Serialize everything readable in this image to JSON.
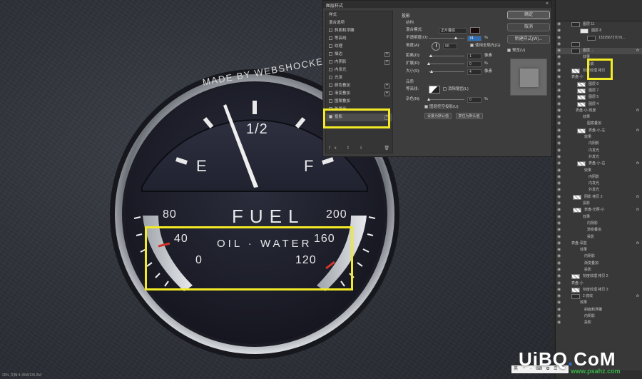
{
  "gauge": {
    "brand": "MADE BY WEBSHOCKER",
    "half": "1/2",
    "empty": "E",
    "full": "F",
    "title": "FUEL",
    "sub_title": "OIL · WATER",
    "left_scale": [
      "80",
      "40",
      "0"
    ],
    "right_scale": [
      "200",
      "160",
      "120"
    ],
    "needle_value": "≈ 1/2"
  },
  "dialog": {
    "title": "图层样式",
    "close": "×",
    "left_items": [
      {
        "label": "样式",
        "check": null
      },
      {
        "label": "混合选项",
        "check": null
      },
      {
        "label": "斜面和浮雕",
        "check": false
      },
      {
        "label": "等高线",
        "check": false
      },
      {
        "label": "纹理",
        "check": false
      },
      {
        "label": "描边",
        "check": false,
        "plus": true
      },
      {
        "label": "内阴影",
        "check": false,
        "plus": true
      },
      {
        "label": "内发光",
        "check": false
      },
      {
        "label": "光泽",
        "check": false
      },
      {
        "label": "颜色叠加",
        "check": false,
        "plus": true
      },
      {
        "label": "渐变叠加",
        "check": false,
        "plus": true
      },
      {
        "label": "图案叠加",
        "check": false
      },
      {
        "label": "外发光",
        "check": false
      },
      {
        "label": "投影",
        "check": true,
        "plus": true,
        "selected": true
      }
    ],
    "left_footer": "fx ⇧ ⇩",
    "trash": "🗑",
    "section": "投影",
    "subsection": "结构",
    "blend_label": "混合模式:",
    "blend_value": "正片叠底",
    "opacity_label": "不透明度(O):",
    "opacity_value": "74",
    "angle_label": "角度(A):",
    "angle_value": "90",
    "global_light": "使用全局光(G)",
    "distance_label": "距离(D):",
    "distance_value": "1",
    "spread_label": "扩展(R):",
    "spread_value": "0",
    "size_label": "大小(S):",
    "size_value": "4",
    "unit_px": "像素",
    "unit_pct": "%",
    "quality_head": "品质",
    "contour_label": "等高线:",
    "antialias": "消除锯齿(L)",
    "noise_label": "杂色(N):",
    "noise_value": "0",
    "knockout": "图层挖空投影(U)",
    "btn_default": "设置为默认值",
    "btn_reset": "复位为默认值",
    "ok": "确定",
    "cancel": "取消",
    "new_style": "新建样式(W)...",
    "preview": "预览(V)"
  },
  "layers": {
    "rows": [
      {
        "name": "图层 11",
        "thumb": "dark",
        "indent": 14,
        "fx": false
      },
      {
        "name": "图层 8",
        "thumb": "light",
        "indent": 26,
        "fx": false
      },
      {
        "name": "1332567270 N...",
        "thumb": "dark",
        "indent": 36,
        "fx": false
      },
      {
        "name": "",
        "thumb": "dark",
        "indent": 14,
        "fx": false
      },
      {
        "name": "图层 ...",
        "thumb": "dark",
        "indent": 14,
        "fx": true,
        "selected": true
      },
      {
        "name": "效果",
        "thumb": null,
        "indent": 26,
        "fx": false
      },
      {
        "name": "投影",
        "thumb": null,
        "indent": 32,
        "fx": false
      },
      {
        "name": "刻度纹理 拷贝",
        "thumb": "chk",
        "indent": 14,
        "fx": false
      },
      {
        "name": "表盘-小",
        "thumb": null,
        "indent": 10,
        "fx": false
      },
      {
        "name": "图层 6",
        "thumb": "chk",
        "indent": 22,
        "fx": false
      },
      {
        "name": "图层 7",
        "thumb": "chk",
        "indent": 22,
        "fx": false
      },
      {
        "name": "图层 5",
        "thumb": "chk",
        "indent": 22,
        "fx": false
      },
      {
        "name": "图层 4",
        "thumb": "chk",
        "indent": 22,
        "fx": false
      },
      {
        "name": "表盘-小-刻度",
        "thumb": null,
        "indent": 16,
        "fx": true
      },
      {
        "name": "效果",
        "thumb": null,
        "indent": 26,
        "fx": false
      },
      {
        "name": "图案叠加",
        "thumb": null,
        "indent": 32,
        "fx": false
      },
      {
        "name": "表盘-小-左",
        "thumb": "chk",
        "indent": 22,
        "fx": true
      },
      {
        "name": "效果",
        "thumb": null,
        "indent": 28,
        "fx": false
      },
      {
        "name": "内阴影",
        "thumb": null,
        "indent": 34,
        "fx": false
      },
      {
        "name": "内发光",
        "thumb": null,
        "indent": 34,
        "fx": false
      },
      {
        "name": "外发光",
        "thumb": null,
        "indent": 34,
        "fx": false
      },
      {
        "name": "表盘-小-右",
        "thumb": "chk",
        "indent": 22,
        "fx": true
      },
      {
        "name": "效果",
        "thumb": null,
        "indent": 28,
        "fx": false
      },
      {
        "name": "内阴影",
        "thumb": null,
        "indent": 34,
        "fx": false
      },
      {
        "name": "内发光",
        "thumb": null,
        "indent": 34,
        "fx": false
      },
      {
        "name": "外发光",
        "thumb": null,
        "indent": 34,
        "fx": false
      },
      {
        "name": "阴影 拷贝 2",
        "thumb": "chk",
        "indent": 16,
        "fx": true
      },
      {
        "name": "投影",
        "thumb": null,
        "indent": 26,
        "fx": false
      },
      {
        "name": "表盘-光照-小",
        "thumb": "chk",
        "indent": 16,
        "fx": true
      },
      {
        "name": "效果",
        "thumb": null,
        "indent": 26,
        "fx": false
      },
      {
        "name": "内阴影",
        "thumb": null,
        "indent": 32,
        "fx": false
      },
      {
        "name": "渐变叠加",
        "thumb": null,
        "indent": 32,
        "fx": false
      },
      {
        "name": "投影",
        "thumb": null,
        "indent": 32,
        "fx": false
      },
      {
        "name": "表盘-深蓝",
        "thumb": null,
        "indent": 10,
        "fx": true
      },
      {
        "name": "效果",
        "thumb": null,
        "indent": 22,
        "fx": false
      },
      {
        "name": "内阴影",
        "thumb": null,
        "indent": 28,
        "fx": false
      },
      {
        "name": "渐变叠加",
        "thumb": null,
        "indent": 28,
        "fx": false
      },
      {
        "name": "投影",
        "thumb": null,
        "indent": 28,
        "fx": false
      },
      {
        "name": "刻度纹理 拷贝 2",
        "thumb": "chk",
        "indent": 14,
        "fx": false
      },
      {
        "name": "表盘-小",
        "thumb": null,
        "indent": 10,
        "fx": false
      },
      {
        "name": "刻度纹理 拷贝 3",
        "thumb": "chk",
        "indent": 14,
        "fx": false
      },
      {
        "name": "2 底纹",
        "thumb": "dark",
        "indent": 14,
        "fx": true
      },
      {
        "name": "效果",
        "thumb": null,
        "indent": 22,
        "fx": false
      },
      {
        "name": "斜面和浮雕",
        "thumb": null,
        "indent": 28,
        "fx": false
      },
      {
        "name": "内阴影",
        "thumb": null,
        "indent": 28,
        "fx": false
      },
      {
        "name": "投影",
        "thumb": null,
        "indent": 28,
        "fx": false
      }
    ]
  },
  "status": "25% 文档:4.35M/135.9M",
  "watermark": {
    "left": "UiBQ",
    "dot": ".",
    "right": "CoM",
    "sub": "www.psahz.com"
  },
  "ime": "英 ・ ◦ ⌨ ✿ ☰"
}
